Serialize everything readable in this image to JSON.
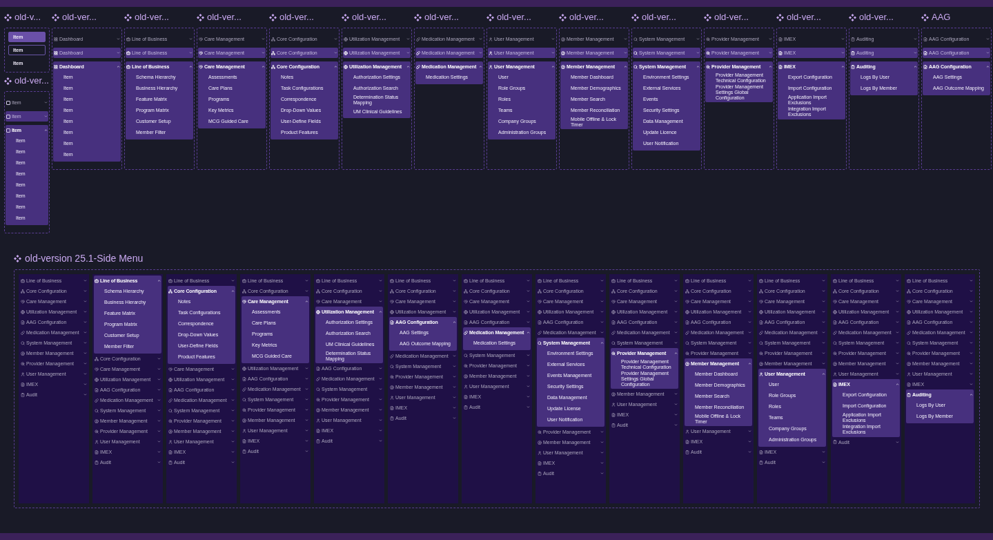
{
  "top_columns": [
    {
      "sets": [
        {
          "title": "old-v...",
          "variants": [
            {
              "kind": "button",
              "label": "Item",
              "filled": true,
              "focused": false
            },
            {
              "kind": "button",
              "label": "Item",
              "filled": false,
              "focused": true
            },
            {
              "kind": "button",
              "label": "Item",
              "filled": false,
              "focused": false
            }
          ]
        },
        {
          "title": "old-ver...",
          "variants": [
            {
              "kind": "checkbox",
              "label": "Item",
              "checked": false,
              "filled": false,
              "expanded": false
            },
            {
              "kind": "checkbox",
              "label": "Item",
              "checked": false,
              "filled": true,
              "expanded": false
            },
            {
              "kind": "checkbox",
              "label": "Item",
              "checked": false,
              "filled": true,
              "expanded": true,
              "children": [
                "Item",
                "Item",
                "Item",
                "Item",
                "Item",
                "Item",
                "Item",
                "Item"
              ]
            }
          ]
        }
      ]
    },
    {
      "sets": [
        {
          "title": "old-ver...",
          "variants": [
            {
              "kind": "dashboard",
              "label": "Dashboard",
              "filled": false,
              "expanded": false
            },
            {
              "kind": "dashboard",
              "label": "Dashboard",
              "filled": true,
              "expanded": false
            },
            {
              "kind": "dashboard",
              "label": "Dashboard",
              "filled": true,
              "expanded": true,
              "children": [
                "Item",
                "Item",
                "Item",
                "Item",
                "Item",
                "Item",
                "Item",
                "Item"
              ]
            }
          ]
        }
      ]
    },
    {
      "sets": [
        {
          "title": "old-ver...",
          "variants": [
            {
              "kind": "business",
              "label": "Line of Business",
              "filled": false,
              "expanded": false
            },
            {
              "kind": "business",
              "label": "Line of Business",
              "filled": true,
              "expanded": false
            },
            {
              "kind": "business",
              "label": "Line of Business",
              "filled": true,
              "expanded": true,
              "children": [
                "Schema Hierarchy",
                "Business Hierarchy",
                "Feature Matrix",
                "Program Matrix",
                "Customer Setup",
                "Member Filter"
              ]
            }
          ]
        }
      ]
    },
    {
      "sets": [
        {
          "title": "old-ver...",
          "variants": [
            {
              "kind": "care",
              "label": "Care Management",
              "filled": false,
              "expanded": false
            },
            {
              "kind": "care",
              "label": "Care Management",
              "filled": true,
              "expanded": false
            },
            {
              "kind": "care",
              "label": "Care Management",
              "filled": true,
              "expanded": true,
              "children": [
                "Assessments",
                "Care Plans",
                "Programs",
                "Key Metrics",
                "MCG Guided Care"
              ]
            }
          ]
        }
      ]
    },
    {
      "sets": [
        {
          "title": "old-ver...",
          "variants": [
            {
              "kind": "config",
              "label": "Core Configuration",
              "filled": false,
              "expanded": false
            },
            {
              "kind": "config",
              "label": "Core Configuration",
              "filled": true,
              "expanded": false
            },
            {
              "kind": "config",
              "label": "Core Configuration",
              "filled": true,
              "expanded": true,
              "children": [
                "Notes",
                "Task Configurations",
                "Correspondence",
                "Drop-Down Values",
                "User-Define Fields",
                "Product Features"
              ]
            }
          ]
        }
      ]
    },
    {
      "sets": [
        {
          "title": "old-ver...",
          "variants": [
            {
              "kind": "utilization",
              "label": "Utilization Management",
              "filled": false,
              "expanded": false
            },
            {
              "kind": "utilization",
              "label": "Utilization Management",
              "filled": true,
              "expanded": false
            },
            {
              "kind": "utilization",
              "label": "Utilization Management",
              "filled": true,
              "expanded": true,
              "children": [
                "Authorization Settings",
                "Authorization Search",
                "Determination Status Mapping",
                "UM Clinical Guidelines"
              ]
            }
          ]
        }
      ]
    },
    {
      "sets": [
        {
          "title": "old-ver...",
          "variants": [
            {
              "kind": "medication",
              "label": "Medication Management",
              "filled": false,
              "expanded": false
            },
            {
              "kind": "medication",
              "label": "Medication Management",
              "filled": true,
              "expanded": false
            },
            {
              "kind": "medication",
              "label": "Medication Management",
              "filled": true,
              "expanded": true,
              "children": [
                "Medication Settings"
              ]
            }
          ]
        }
      ]
    },
    {
      "sets": [
        {
          "title": "old-ver...",
          "variants": [
            {
              "kind": "user",
              "label": "User Management",
              "filled": false,
              "expanded": false
            },
            {
              "kind": "user",
              "label": "User Management",
              "filled": true,
              "expanded": false
            },
            {
              "kind": "user",
              "label": "User Management",
              "filled": true,
              "expanded": true,
              "children": [
                "User",
                "Role Groups",
                "Roles",
                "Teams",
                "Company Groups",
                "Administration Groups"
              ]
            }
          ]
        }
      ]
    },
    {
      "sets": [
        {
          "title": "old-ver...",
          "variants": [
            {
              "kind": "member",
              "label": "Member Management",
              "filled": false,
              "expanded": false
            },
            {
              "kind": "member",
              "label": "Member Management",
              "filled": true,
              "expanded": false
            },
            {
              "kind": "member",
              "label": "Member Management",
              "filled": true,
              "expanded": true,
              "children": [
                "Member Dashboard",
                "Member Demographics",
                "Member Search",
                "Member Reconciliation",
                "Mobile Offline & Lock Timer"
              ]
            }
          ]
        }
      ]
    },
    {
      "sets": [
        {
          "title": "old-ver...",
          "variants": [
            {
              "kind": "system",
              "label": "System Management",
              "filled": false,
              "expanded": false
            },
            {
              "kind": "system",
              "label": "System Management",
              "filled": true,
              "expanded": false
            },
            {
              "kind": "system",
              "label": "System Management",
              "filled": true,
              "expanded": true,
              "children": [
                "Environment Settings",
                "External Services",
                "Events",
                "Security Settings",
                "Data Management",
                "Update Licence",
                "User Notification"
              ]
            }
          ]
        }
      ]
    },
    {
      "sets": [
        {
          "title": "old-ver...",
          "variants": [
            {
              "kind": "provider",
              "label": "Provider Management",
              "filled": false,
              "expanded": false
            },
            {
              "kind": "provider",
              "label": "Provider Management",
              "filled": true,
              "expanded": false
            },
            {
              "kind": "provider",
              "label": "Provider Management",
              "filled": true,
              "expanded": true,
              "children": [
                "Provider Management Technical Configuration",
                "Provider Management Settings Global Configuration"
              ]
            }
          ]
        }
      ]
    },
    {
      "sets": [
        {
          "title": "old-ver...",
          "variants": [
            {
              "kind": "imex",
              "label": "IMEX",
              "filled": false,
              "expanded": false
            },
            {
              "kind": "imex",
              "label": "IMEX",
              "filled": true,
              "expanded": false
            },
            {
              "kind": "imex",
              "label": "IMEX",
              "filled": true,
              "expanded": true,
              "children": [
                "Export Configuration",
                "Import Configuration",
                "Application Import Exclusions",
                "Integration Import Exclusions"
              ]
            }
          ]
        }
      ]
    },
    {
      "sets": [
        {
          "title": "old-ver...",
          "variants": [
            {
              "kind": "audit",
              "label": "Auditing",
              "filled": false,
              "expanded": false
            },
            {
              "kind": "audit",
              "label": "Auditing",
              "filled": true,
              "expanded": false
            },
            {
              "kind": "audit",
              "label": "Auditing",
              "filled": true,
              "expanded": true,
              "children": [
                "Logs By User",
                "Logs By Member"
              ]
            }
          ]
        }
      ]
    },
    {
      "sets": [
        {
          "title": "AAG",
          "variants": [
            {
              "kind": "aag",
              "label": "AAG Configuration",
              "filled": false,
              "expanded": false
            },
            {
              "kind": "aag",
              "label": "AAG Configuration",
              "filled": true,
              "expanded": false
            },
            {
              "kind": "aag",
              "label": "AAG Configuration",
              "filled": true,
              "expanded": true,
              "children": [
                "AAG Settings",
                "AAG Outcome Mapping"
              ]
            }
          ]
        }
      ]
    }
  ],
  "side_menu": {
    "title": "old-version 25.1-Side Menu",
    "panels": [
      {
        "items": [
          {
            "label": "Line of Business",
            "kind": "business",
            "expanded": false
          },
          {
            "label": "Core Configuration",
            "kind": "config",
            "expanded": false
          },
          {
            "label": "Care Management",
            "kind": "care",
            "expanded": false
          },
          {
            "label": "Utilization Management",
            "kind": "utilization",
            "expanded": false
          },
          {
            "label": "AAG Configuration",
            "kind": "aag",
            "expanded": false
          },
          {
            "label": "Medication Management",
            "kind": "medication",
            "expanded": false
          },
          {
            "label": "System Management",
            "kind": "system",
            "expanded": false
          },
          {
            "label": "Member Management",
            "kind": "member",
            "expanded": false
          },
          {
            "label": "Provider Management",
            "kind": "provider",
            "expanded": false
          },
          {
            "label": "User Management",
            "kind": "user",
            "expanded": false
          },
          {
            "label": "IMEX",
            "kind": "imex",
            "expanded": false
          },
          {
            "label": "Audit",
            "kind": "audit",
            "expanded": false
          }
        ]
      },
      {
        "items": [
          {
            "label": "Line of Business",
            "kind": "business",
            "expanded": true,
            "children": [
              "Schema Hierarchy",
              "Business Hierarchy",
              "Feature Matrix",
              "Program Matrix",
              "Customer Setup",
              "Member Filter"
            ]
          },
          {
            "label": "Core Configuration",
            "kind": "config",
            "expanded": false
          },
          {
            "label": "Care Management",
            "kind": "care",
            "expanded": false
          },
          {
            "label": "Utilization Management",
            "kind": "utilization",
            "expanded": false
          },
          {
            "label": "AAG Configuration",
            "kind": "aag",
            "expanded": false
          },
          {
            "label": "Medication Management",
            "kind": "medication",
            "expanded": false
          },
          {
            "label": "System Management",
            "kind": "system",
            "expanded": false
          },
          {
            "label": "Member Management",
            "kind": "member",
            "expanded": false
          },
          {
            "label": "Provider Management",
            "kind": "provider",
            "expanded": false
          },
          {
            "label": "User Management",
            "kind": "user",
            "expanded": false
          },
          {
            "label": "IMEX",
            "kind": "imex",
            "expanded": false
          },
          {
            "label": "Audit",
            "kind": "audit",
            "expanded": false
          }
        ]
      },
      {
        "items": [
          {
            "label": "Line of Business",
            "kind": "business",
            "expanded": false
          },
          {
            "label": "Core Configuration",
            "kind": "config",
            "expanded": true,
            "children": [
              "Notes",
              "Task Configurations",
              "Correspondence",
              "Drop-Down Values",
              "User-Define Fields",
              "Product Features"
            ]
          },
          {
            "label": "Care Management",
            "kind": "care",
            "expanded": false
          },
          {
            "label": "Utilization Management",
            "kind": "utilization",
            "expanded": false
          },
          {
            "label": "AAG Configuration",
            "kind": "aag",
            "expanded": false
          },
          {
            "label": "Medication Management",
            "kind": "medication",
            "expanded": false
          },
          {
            "label": "System Management",
            "kind": "system",
            "expanded": false
          },
          {
            "label": "Provider Management",
            "kind": "provider",
            "expanded": false
          },
          {
            "label": "Member Management",
            "kind": "member",
            "expanded": false
          },
          {
            "label": "User Management",
            "kind": "user",
            "expanded": false
          },
          {
            "label": "IMEX",
            "kind": "imex",
            "expanded": false
          },
          {
            "label": "Audit",
            "kind": "audit",
            "expanded": false
          }
        ]
      },
      {
        "items": [
          {
            "label": "Line of Business",
            "kind": "business",
            "expanded": false
          },
          {
            "label": "Core Configuration",
            "kind": "config",
            "expanded": false
          },
          {
            "label": "Care Management",
            "kind": "care",
            "expanded": true,
            "children": [
              "Assessments",
              "Care Plans",
              "Programs",
              "Key Metrics",
              "MCG Guided Care"
            ]
          },
          {
            "label": "Utilization Management",
            "kind": "utilization",
            "expanded": false
          },
          {
            "label": "AAG Configuration",
            "kind": "aag",
            "expanded": false
          },
          {
            "label": "Medication Management",
            "kind": "medication",
            "expanded": false
          },
          {
            "label": "System Management",
            "kind": "system",
            "expanded": false
          },
          {
            "label": "Provider Management",
            "kind": "provider",
            "expanded": false
          },
          {
            "label": "Member Management",
            "kind": "member",
            "expanded": false
          },
          {
            "label": "User Management",
            "kind": "user",
            "expanded": false
          },
          {
            "label": "IMEX",
            "kind": "imex",
            "expanded": false
          },
          {
            "label": "Audit",
            "kind": "audit",
            "expanded": false
          }
        ]
      },
      {
        "items": [
          {
            "label": "Line of Business",
            "kind": "business",
            "expanded": false
          },
          {
            "label": "Core Configuration",
            "kind": "config",
            "expanded": false
          },
          {
            "label": "Care Management",
            "kind": "care",
            "expanded": false
          },
          {
            "label": "Utilization Management",
            "kind": "utilization",
            "expanded": true,
            "children": [
              "Authorization Settings",
              "Authorization Search",
              "UM Clinical Guidelines",
              "Determination Status Mapping"
            ]
          },
          {
            "label": "AAG Configuration",
            "kind": "aag",
            "expanded": false
          },
          {
            "label": "Medication Management",
            "kind": "medication",
            "expanded": false
          },
          {
            "label": "System Management",
            "kind": "system",
            "expanded": false
          },
          {
            "label": "Provider Management",
            "kind": "provider",
            "expanded": false
          },
          {
            "label": "Member Management",
            "kind": "member",
            "expanded": false
          },
          {
            "label": "User Management",
            "kind": "user",
            "expanded": false
          },
          {
            "label": "IMEX",
            "kind": "imex",
            "expanded": false
          },
          {
            "label": "Audit",
            "kind": "audit",
            "expanded": false
          }
        ]
      },
      {
        "items": [
          {
            "label": "Line of Business",
            "kind": "business",
            "expanded": false
          },
          {
            "label": "Core Configuration",
            "kind": "config",
            "expanded": false
          },
          {
            "label": "Care Management",
            "kind": "care",
            "expanded": false
          },
          {
            "label": "Utilization Management",
            "kind": "utilization",
            "expanded": false
          },
          {
            "label": "AAG Configuration",
            "kind": "aag",
            "expanded": true,
            "children": [
              "AAG Settings",
              "AAG Outcome Mapping"
            ]
          },
          {
            "label": "Medication Management",
            "kind": "medication",
            "expanded": false
          },
          {
            "label": "System Management",
            "kind": "system",
            "expanded": false
          },
          {
            "label": "Provider Management",
            "kind": "provider",
            "expanded": false
          },
          {
            "label": "Member Management",
            "kind": "member",
            "expanded": false
          },
          {
            "label": "User Management",
            "kind": "user",
            "expanded": false
          },
          {
            "label": "IMEX",
            "kind": "imex",
            "expanded": false
          },
          {
            "label": "Audit",
            "kind": "audit",
            "expanded": false
          }
        ]
      },
      {
        "items": [
          {
            "label": "Line of Business",
            "kind": "business",
            "expanded": false
          },
          {
            "label": "Core Configuration",
            "kind": "config",
            "expanded": false
          },
          {
            "label": "Care Management",
            "kind": "care",
            "expanded": false
          },
          {
            "label": "Utilization Management",
            "kind": "utilization",
            "expanded": false
          },
          {
            "label": "AAG Configuration",
            "kind": "aag",
            "expanded": false
          },
          {
            "label": "Medication Management",
            "kind": "medication",
            "expanded": true,
            "children": [
              "Medication Settings"
            ]
          },
          {
            "label": "System Management",
            "kind": "system",
            "expanded": false
          },
          {
            "label": "Provider Management",
            "kind": "provider",
            "expanded": false
          },
          {
            "label": "Member Management",
            "kind": "member",
            "expanded": false
          },
          {
            "label": "User Management",
            "kind": "user",
            "expanded": false
          },
          {
            "label": "IMEX",
            "kind": "imex",
            "expanded": false
          },
          {
            "label": "Audit",
            "kind": "audit",
            "expanded": false
          }
        ]
      },
      {
        "items": [
          {
            "label": "Line of Business",
            "kind": "business",
            "expanded": false
          },
          {
            "label": "Core Configuration",
            "kind": "config",
            "expanded": false
          },
          {
            "label": "Care Management",
            "kind": "care",
            "expanded": false
          },
          {
            "label": "Utilization Management",
            "kind": "utilization",
            "expanded": false
          },
          {
            "label": "AAG Configuration",
            "kind": "aag",
            "expanded": false
          },
          {
            "label": "Medication Management",
            "kind": "medication",
            "expanded": false
          },
          {
            "label": "System Management",
            "kind": "system",
            "expanded": true,
            "children": [
              "Environment Settings",
              "External Services",
              "Events Management",
              "Security Settings",
              "Data Management",
              "Update License",
              "User Notification"
            ]
          },
          {
            "label": "Provider Management",
            "kind": "provider",
            "expanded": false
          },
          {
            "label": "Member Management",
            "kind": "member",
            "expanded": false
          },
          {
            "label": "User Management",
            "kind": "user",
            "expanded": false
          },
          {
            "label": "IMEX",
            "kind": "imex",
            "expanded": false
          },
          {
            "label": "Audit",
            "kind": "audit",
            "expanded": false
          }
        ]
      },
      {
        "items": [
          {
            "label": "Line of Business",
            "kind": "business",
            "expanded": false
          },
          {
            "label": "Core Configuration",
            "kind": "config",
            "expanded": false
          },
          {
            "label": "Care Management",
            "kind": "care",
            "expanded": false
          },
          {
            "label": "Utilization Management",
            "kind": "utilization",
            "expanded": false
          },
          {
            "label": "AAG Configuration",
            "kind": "aag",
            "expanded": false
          },
          {
            "label": "Medication Management",
            "kind": "medication",
            "expanded": false
          },
          {
            "label": "System Management",
            "kind": "system",
            "expanded": false
          },
          {
            "label": "Provider Management",
            "kind": "provider",
            "expanded": true,
            "children": [
              "Provider Management Technical Configuration",
              "Provider Management Settings Global Configuration"
            ]
          },
          {
            "label": "Member Management",
            "kind": "member",
            "expanded": false
          },
          {
            "label": "User Management",
            "kind": "user",
            "expanded": false
          },
          {
            "label": "IMEX",
            "kind": "imex",
            "expanded": false
          },
          {
            "label": "Audit",
            "kind": "audit",
            "expanded": false
          }
        ]
      },
      {
        "items": [
          {
            "label": "Line of Business",
            "kind": "business",
            "expanded": false
          },
          {
            "label": "Core Configuration",
            "kind": "config",
            "expanded": false
          },
          {
            "label": "Care Management",
            "kind": "care",
            "expanded": false
          },
          {
            "label": "Utilization Management",
            "kind": "utilization",
            "expanded": false
          },
          {
            "label": "AAG Configuration",
            "kind": "aag",
            "expanded": false
          },
          {
            "label": "Medication Management",
            "kind": "medication",
            "expanded": false
          },
          {
            "label": "System Management",
            "kind": "system",
            "expanded": false
          },
          {
            "label": "Provider Management",
            "kind": "provider",
            "expanded": false
          },
          {
            "label": "Member Management",
            "kind": "member",
            "expanded": true,
            "children": [
              "Member Dashboard",
              "Member Demographics",
              "Member Search",
              "Member Reconciliation",
              "Mobile Offline & Lock Timer"
            ]
          },
          {
            "label": "User Management",
            "kind": "user",
            "expanded": false
          },
          {
            "label": "IMEX",
            "kind": "imex",
            "expanded": false
          },
          {
            "label": "Audit",
            "kind": "audit",
            "expanded": false
          }
        ]
      },
      {
        "items": [
          {
            "label": "Line of Business",
            "kind": "business",
            "expanded": false
          },
          {
            "label": "Core Configuration",
            "kind": "config",
            "expanded": false
          },
          {
            "label": "Care Management",
            "kind": "care",
            "expanded": false
          },
          {
            "label": "Utilization Management",
            "kind": "utilization",
            "expanded": false
          },
          {
            "label": "AAG Configuration",
            "kind": "aag",
            "expanded": false
          },
          {
            "label": "Medication Management",
            "kind": "medication",
            "expanded": false
          },
          {
            "label": "System Management",
            "kind": "system",
            "expanded": false
          },
          {
            "label": "Provider Management",
            "kind": "provider",
            "expanded": false
          },
          {
            "label": "Member Management",
            "kind": "member",
            "expanded": false
          },
          {
            "label": "User Management",
            "kind": "user",
            "expanded": true,
            "children": [
              "User",
              "Role Groups",
              "Roles",
              "Teams",
              "Company Groups",
              "Administration Groups"
            ]
          },
          {
            "label": "IMEX",
            "kind": "imex",
            "expanded": false
          },
          {
            "label": "Audit",
            "kind": "audit",
            "expanded": false
          }
        ]
      },
      {
        "items": [
          {
            "label": "Line of Business",
            "kind": "business",
            "expanded": false
          },
          {
            "label": "Core Configuration",
            "kind": "config",
            "expanded": false
          },
          {
            "label": "Care Management",
            "kind": "care",
            "expanded": false
          },
          {
            "label": "Utilization Management",
            "kind": "utilization",
            "expanded": false
          },
          {
            "label": "AAG Configuration",
            "kind": "aag",
            "expanded": false
          },
          {
            "label": "Medication Management",
            "kind": "medication",
            "expanded": false
          },
          {
            "label": "System Management",
            "kind": "system",
            "expanded": false
          },
          {
            "label": "Provider Management",
            "kind": "provider",
            "expanded": false
          },
          {
            "label": "Member Management",
            "kind": "member",
            "expanded": false
          },
          {
            "label": "User Management",
            "kind": "user",
            "expanded": false
          },
          {
            "label": "IMEX",
            "kind": "imex",
            "expanded": true,
            "children": [
              "Export Configuration",
              "Import Configuration",
              "Application Import Exclusions",
              "Integration Import Exclusions"
            ]
          },
          {
            "label": "Audit",
            "kind": "audit",
            "expanded": false
          }
        ]
      },
      {
        "items": [
          {
            "label": "Line of Business",
            "kind": "business",
            "expanded": false
          },
          {
            "label": "Core Configuration",
            "kind": "config",
            "expanded": false
          },
          {
            "label": "Care Management",
            "kind": "care",
            "expanded": false
          },
          {
            "label": "Utilization Management",
            "kind": "utilization",
            "expanded": false
          },
          {
            "label": "AAG Configuration",
            "kind": "aag",
            "expanded": false
          },
          {
            "label": "Medication Management",
            "kind": "medication",
            "expanded": false
          },
          {
            "label": "System Management",
            "kind": "system",
            "expanded": false
          },
          {
            "label": "Provider Management",
            "kind": "provider",
            "expanded": false
          },
          {
            "label": "Member Management",
            "kind": "member",
            "expanded": false
          },
          {
            "label": "User Management",
            "kind": "user",
            "expanded": false
          },
          {
            "label": "IMEX",
            "kind": "imex",
            "expanded": false
          },
          {
            "label": "Auditing",
            "kind": "audit",
            "expanded": true,
            "children": [
              "Logs By User",
              "Logs By Member"
            ]
          }
        ]
      }
    ]
  }
}
